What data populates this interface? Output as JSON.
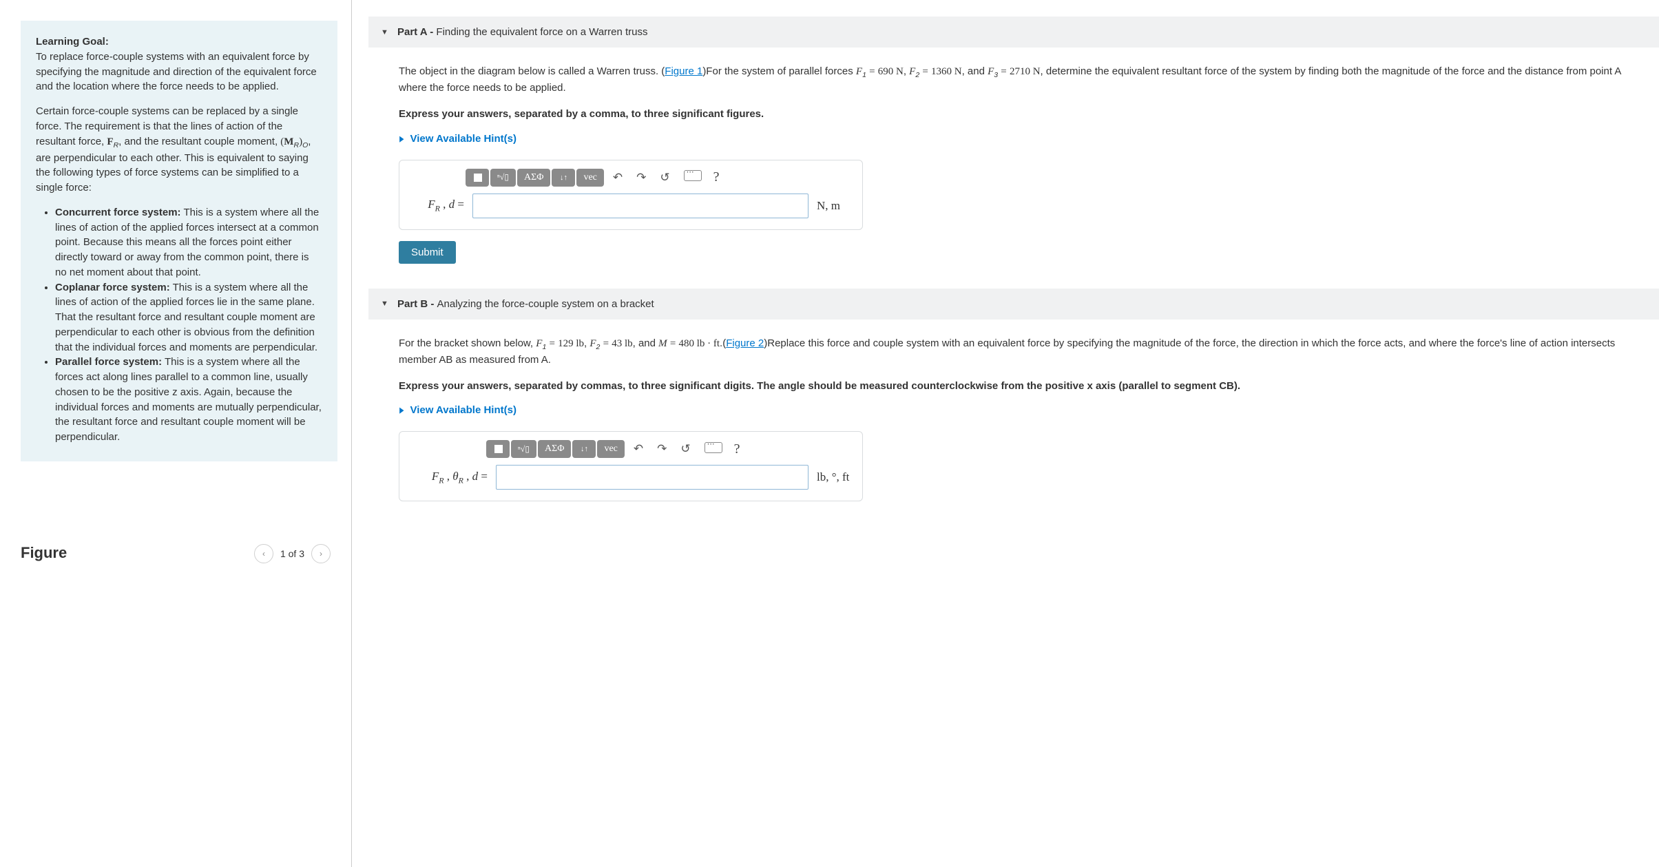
{
  "left": {
    "learning_goal_label": "Learning Goal:",
    "learning_goal_text": "To replace force-couple systems with an equivalent force by specifying the magnitude and direction of the equivalent force and the location where the force needs to be applied.",
    "para2_pre": "Certain force-couple systems can be replaced by a single force. The requirement is that the lines of action of the resultant force, ",
    "para2_mid1": ", and the resultant couple moment, ",
    "para2_mid2": ", are perpendicular to each other. This is equivalent to saying the following types of force systems can be simplified to a single force:",
    "items": [
      {
        "title": "Concurrent force system:",
        "body": " This is a system where all the lines of action of the applied forces intersect at a common point. Because this means all the forces point either directly toward or away from the common point, there is no net moment about that point."
      },
      {
        "title": "Coplanar force system:",
        "body": " This is a system where all the lines of action of the applied forces lie in the same plane. That the resultant force and resultant couple moment are perpendicular to each other is obvious from the definition that the individual forces and moments are perpendicular."
      },
      {
        "title": "Parallel force system:",
        "body": " This is a system where all the forces act along lines parallel to a common line, usually chosen to be the positive z axis. Again, because the individual forces and moments are mutually perpendicular, the resultant force and resultant couple moment will be perpendicular."
      }
    ],
    "figure_title": "Figure",
    "figure_nav_label": "1 of 3"
  },
  "partA": {
    "header_bold": "Part A - ",
    "header_rest": "Finding the equivalent force on a Warren truss",
    "body_pre": "The object in the diagram below is called a Warren truss. (",
    "figure_link": "Figure 1",
    "body_mid1": ")For the system of parallel forces ",
    "f1": "690 N",
    "f2": "1360 N",
    "body_mid2": ", and ",
    "f3": "2710 N",
    "body_post": ", determine the equivalent resultant force of the system by finding both the magnitude of the force and the distance from point A where the force needs to be applied.",
    "express": "Express your answers, separated by a comma, to three significant figures.",
    "hints": "View Available Hint(s)",
    "toolbar": {
      "greek": "ΑΣΦ",
      "vec": "vec"
    },
    "answer_label_html": "F_R , d =",
    "units": "N, m",
    "submit": "Submit"
  },
  "partB": {
    "header_bold": "Part B - ",
    "header_rest": "Analyzing the force-couple system on a bracket",
    "body_pre": "For the bracket shown below, ",
    "f1": "129 lb",
    "f2": "43 lb",
    "m_val": "480 lb · ft",
    "figure_link": "Figure 2",
    "body_mid": ".(",
    "body_post": ")Replace this force and couple system with an equivalent force by specifying the magnitude of the force, the direction in which the force acts, and where the force's line of action intersects member AB as measured from A.",
    "express": "Express your answers, separated by commas, to three significant digits. The angle should be measured counterclockwise from the positive x axis (parallel to segment CB).",
    "hints": "View Available Hint(s)",
    "answer_label_html": "F_R , θ_R , d =",
    "units": "lb, °, ft"
  }
}
